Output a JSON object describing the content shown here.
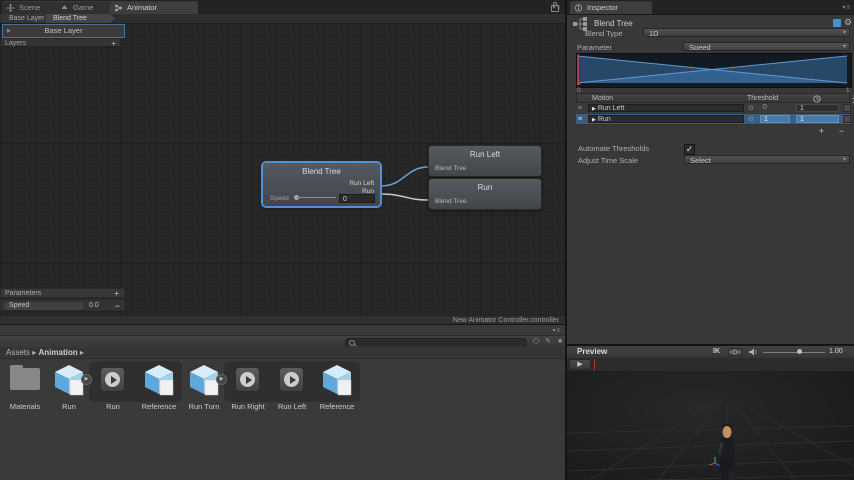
{
  "glyphs": {
    "expander": "▶",
    "caret": "▾",
    "picker": "⊙",
    "drag": "≡",
    "plus": "+",
    "minus": "−",
    "check": "✓",
    "sep": "▸",
    "play": "▶",
    "winmenu": "▾≡"
  },
  "animator": {
    "tabs": [
      "Scene",
      "Game",
      "Animator"
    ],
    "breadcrumb": {
      "layer": "Base Layer",
      "node": "Blend Tree"
    },
    "layers_panel": {
      "selected_layer": "Base Layer",
      "header": "Layers",
      "add_label": "+"
    },
    "graph": {
      "blend_node": {
        "title": "Blend Tree",
        "output_1": "Run Left",
        "output_2": "Run",
        "param_label": "Speed",
        "param_value": "0"
      },
      "node_run_left": {
        "title": "Run Left",
        "tag": "Blend Tree"
      },
      "node_run": {
        "title": "Run",
        "tag": "Blend Tree"
      }
    },
    "parameters_panel": {
      "header": "Parameters",
      "add_label": "+",
      "param_name": "Speed",
      "param_value": "0.0",
      "remove_label": "−"
    },
    "status_text": "New Animator Controller.controller"
  },
  "project": {
    "breadcrumb_root": "Assets",
    "breadcrumb_sep": "▸",
    "breadcrumb_folder": "Animation",
    "assets": [
      {
        "label": "Materials"
      },
      {
        "label": "Run"
      },
      {
        "label": "Run"
      },
      {
        "label": "Reference"
      },
      {
        "label": "Run Turn"
      },
      {
        "label": "Run Right"
      },
      {
        "label": "Run Left"
      },
      {
        "label": "Reference"
      }
    ]
  },
  "inspector": {
    "tab_label": "Inspector",
    "title": "Blend Tree",
    "blend_type_label": "Blend Type",
    "blend_type_value": "1D",
    "parameter_label": "Parameter",
    "parameter_value": "Speed",
    "graph_min": "0",
    "graph_max": "1",
    "motion": {
      "col_motion": "Motion",
      "col_threshold": "Threshold",
      "rows": [
        {
          "name": "Run Left",
          "threshold": "0",
          "speed": "1"
        },
        {
          "name": "Run",
          "threshold": "1",
          "speed": "1"
        }
      ],
      "add_label": "+",
      "remove_label": "−"
    },
    "automate_label": "Automate Thresholds",
    "automate_check": "✓",
    "adjust_label": "Adjust Time Scale",
    "adjust_value": "Select"
  },
  "preview": {
    "title": "Preview",
    "ik_label": "IK",
    "speed_value": "1.00",
    "play_icon": "▶"
  },
  "colors": {
    "accent": "#4f90d9",
    "selection": "#3a5f85",
    "playhead": "#cc3a3a",
    "blend_fill": "#3f7cb4",
    "node_bg": "#4a4e53"
  }
}
